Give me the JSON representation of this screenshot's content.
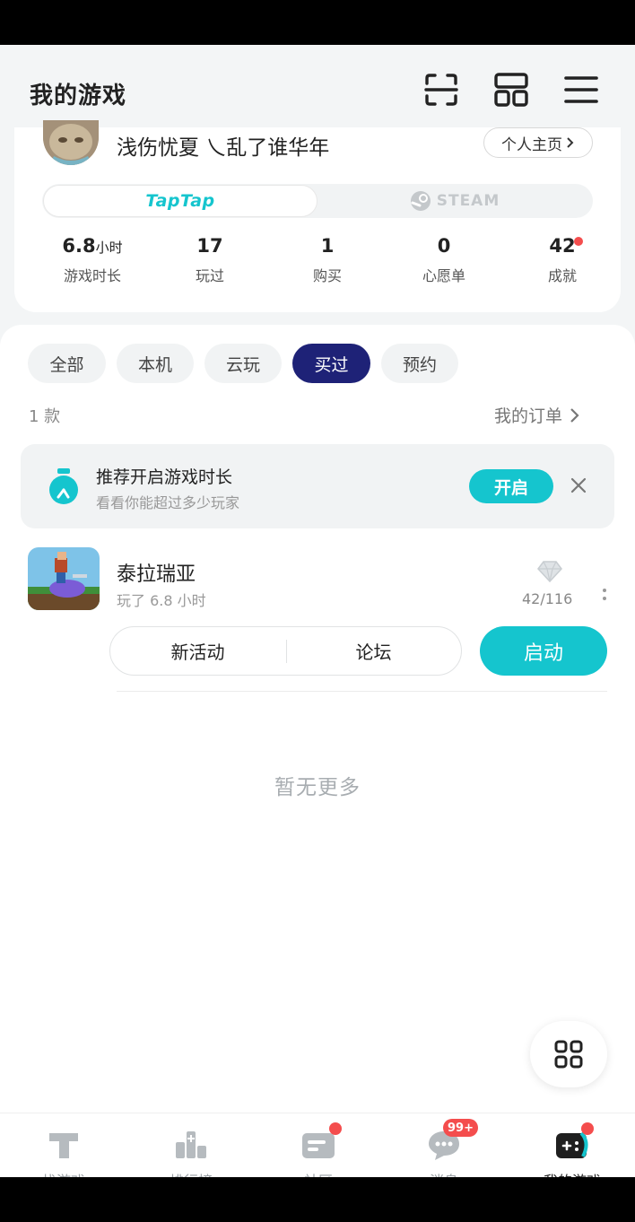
{
  "header": {
    "title": "我的游戏",
    "icons": [
      "scan-icon",
      "grid-icon",
      "menu-icon"
    ]
  },
  "profile": {
    "username": "浅伤忧夏 乀乱了谁华年",
    "home_button": "个人主页",
    "platforms": {
      "active": "TapTap",
      "inactive": "STEAM"
    },
    "stats": [
      {
        "value": "6.8",
        "unit": "小时",
        "label": "游戏时长"
      },
      {
        "value": "17",
        "unit": "",
        "label": "玩过"
      },
      {
        "value": "1",
        "unit": "",
        "label": "购买"
      },
      {
        "value": "0",
        "unit": "",
        "label": "心愿单"
      },
      {
        "value": "42",
        "unit": "",
        "label": "成就",
        "has_dot": true
      }
    ]
  },
  "filters": {
    "items": [
      "全部",
      "本机",
      "云玩",
      "买过",
      "预约"
    ],
    "selected": "买过"
  },
  "list": {
    "count": "1 款",
    "orders_link": "我的订单"
  },
  "recommend": {
    "title": "推荐开启游戏时长",
    "subtitle": "看看你能超过多少玩家",
    "button": "开启"
  },
  "game": {
    "name": "泰拉瑞亚",
    "played": "玩了 6.8 小时",
    "achievements": "42/116",
    "action_news": "新活动",
    "action_forum": "论坛",
    "launch": "启动"
  },
  "empty_hint": "暂无更多",
  "tabbar": {
    "items": [
      {
        "label": "找游戏",
        "icon": "taptap-icon"
      },
      {
        "label": "排行榜",
        "icon": "ranking-icon"
      },
      {
        "label": "社区",
        "icon": "community-icon",
        "dot": true
      },
      {
        "label": "消息",
        "icon": "message-icon",
        "badge": "99+"
      },
      {
        "label": "我的游戏",
        "icon": "gamepad-icon",
        "dot": true,
        "active": true
      }
    ]
  },
  "colors": {
    "accent": "#15c5ce",
    "active_filter": "#1e2277",
    "badge_red": "#f44d4d"
  }
}
